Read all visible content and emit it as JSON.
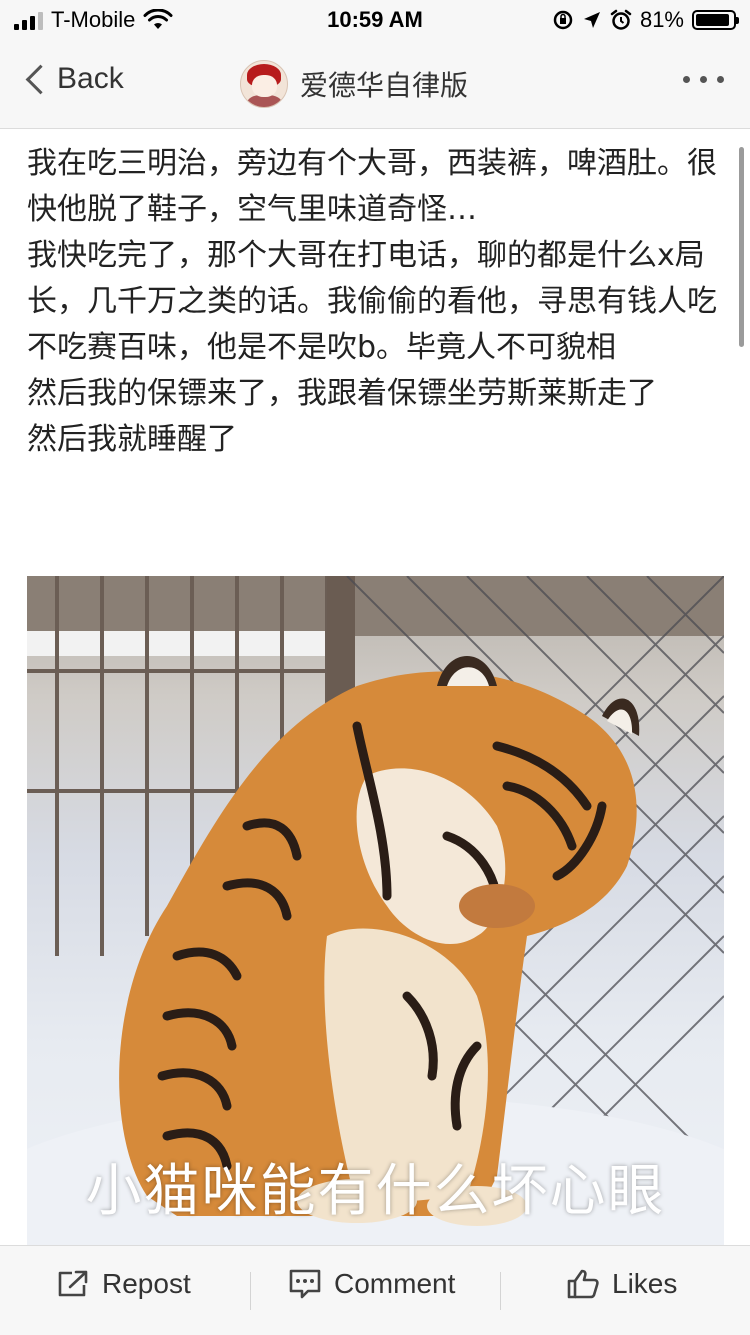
{
  "status_bar": {
    "carrier": "T-Mobile",
    "time": "10:59 AM",
    "battery": "81%",
    "icons": [
      "signal-icon",
      "wifi-icon",
      "screen-rotation-lock-icon",
      "location-icon",
      "alarm-icon",
      "battery-icon"
    ]
  },
  "nav": {
    "back_label": "Back",
    "username": "爱德华自律版",
    "more_icon": "more-dots-icon"
  },
  "post": {
    "paragraphs": [
      "我在吃三明治，旁边有个大哥，西装裤，啤酒肚。很快他脱了鞋子，空气里味道奇怪…",
      "我快吃完了，那个大哥在打电话，聊的都是什么x局长，几千万之类的话。我偷偷的看他，寻思有钱人吃不吃赛百味，他是不是吹b。毕竟人不可貌相",
      "然后我的保镖来了，我跟着保镖坐劳斯莱斯走了",
      "然后我就睡醒了"
    ],
    "image_caption": "小猫咪能有什么坏心眼"
  },
  "actions": {
    "repost": "Repost",
    "comment": "Comment",
    "likes": "Likes"
  }
}
